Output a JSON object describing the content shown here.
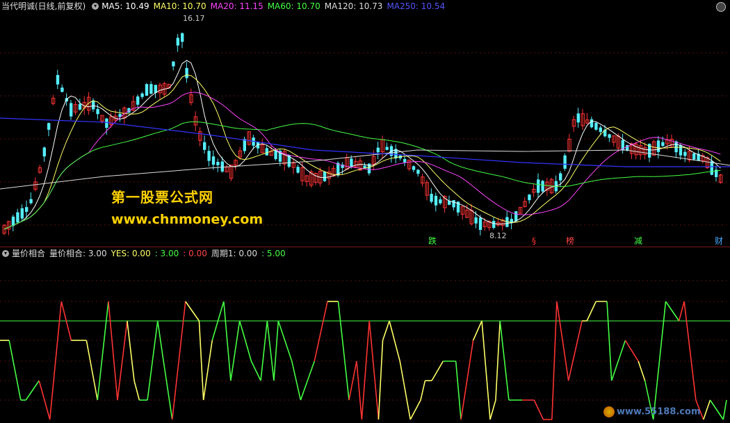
{
  "header": {
    "title": "当代明诚(日线,前复权)",
    "dropdown_icon": "chevron-down-icon",
    "ma": [
      {
        "label": "MA5: 10.49",
        "color": "#ffffff"
      },
      {
        "label": "MA10: 10.70",
        "color": "#ffff66"
      },
      {
        "label": "MA20: 11.15",
        "color": "#ff44ff"
      },
      {
        "label": "MA60: 10.70",
        "color": "#44ff44"
      },
      {
        "label": "MA120: 10.73",
        "color": "#dddddd"
      },
      {
        "label": "MA250: 10.54",
        "color": "#4444ff"
      }
    ]
  },
  "chart": {
    "high_label": "16.17",
    "low_label": "8.12",
    "events": [
      {
        "label": "跌",
        "color": "#44ff44"
      },
      {
        "label": "§",
        "color": "#ff3333"
      },
      {
        "label": "榜",
        "color": "#ff4444"
      },
      {
        "label": "减",
        "color": "#44ff44"
      },
      {
        "label": "财",
        "color": "#44aaff"
      }
    ]
  },
  "watermark": {
    "title": "第一股票公式网",
    "url": "www.chnmoney.com",
    "logo_text": "www.55188.com"
  },
  "indicator": {
    "name": "量价相合",
    "values": [
      {
        "label": "量价相合: 3.00",
        "color": "#dddddd"
      },
      {
        "label": "YES: 0.00",
        "color": "#ffff66"
      },
      {
        "label": ": 3.00",
        "color": "#44ff44"
      },
      {
        "label": ": 0.00",
        "color": "#ff4444"
      },
      {
        "label": "周期1: 0.00",
        "color": "#dddddd"
      },
      {
        "label": ": 5.00",
        "color": "#44ff44"
      }
    ]
  },
  "colors": {
    "up": "#ff3333",
    "down": "#55eeff",
    "background": "#000000"
  }
}
